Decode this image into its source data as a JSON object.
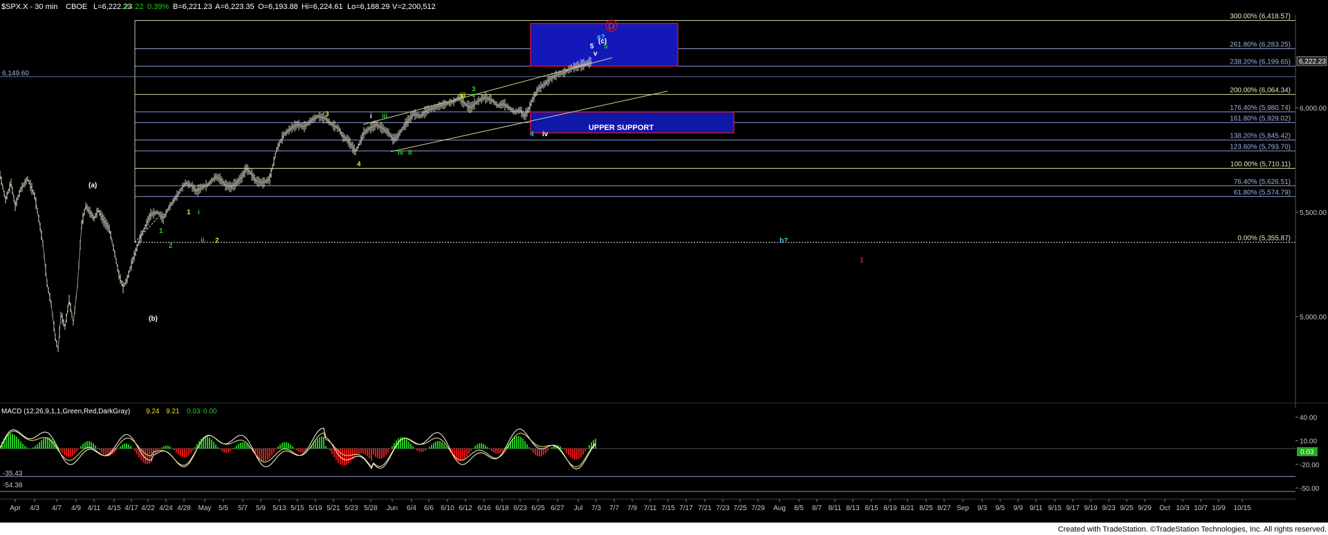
{
  "header": {
    "symbol": "$SPX.X - 30 min",
    "exchange": "CBOE",
    "last": "L=6,222.23",
    "change": "24.22",
    "pct": "0.39%",
    "bid": "B=6,221.23",
    "ask": "A=6,223.35",
    "open": "O=6,193.88",
    "high": "Hi=6,224.61",
    "low": "Lo=6,188.29",
    "volume": "V=2,200,512"
  },
  "macd_header": {
    "label": "MACD (12,26,9,1,1,Green,Red,DarkGray)",
    "v1": "9.24",
    "v2": "9.21",
    "v3": "0.03",
    "v4": "0.00"
  },
  "footer": "Created with TradeStation. ©TradeStation Technologies, Inc. All rights reserved.",
  "colors": {
    "background": "#000000",
    "price_bar": "#d8d8c8",
    "fib_line": "#c8c8c0",
    "fib_blue": "#1030c8",
    "support_box": "#1018a8",
    "support_border": "#c01838",
    "macd_pos": "#22c822",
    "macd_neg": "#e01818",
    "macd_line": "#ffffff",
    "signal_line": "#f0f080",
    "axis_text": "#c8c8c8"
  },
  "chart_data": {
    "type": "line",
    "title": "$SPX.X - 30 min",
    "price_axis": {
      "ticks": [
        "6,000.00",
        "5,500.00",
        "5,000.00"
      ],
      "current": "6,222.23",
      "ylim": [
        4600,
        6530
      ]
    },
    "level_left": "6,149.60",
    "fib_levels": [
      {
        "label": "300.00% (6,418.57)",
        "value": 6418.57,
        "tone": "yellow"
      },
      {
        "label": "261.80% (6,283.25)",
        "value": 6283.25,
        "tone": "blue"
      },
      {
        "label": "238.20% (6,199.65)",
        "value": 6199.65,
        "tone": "blue"
      },
      {
        "label": "200.00% (6,064.34)",
        "value": 6064.34,
        "tone": "yellow"
      },
      {
        "label": "176.40% (5,980.74)",
        "value": 5980.74,
        "tone": "blue"
      },
      {
        "label": "161.80% (5,929.02)",
        "value": 5929.02,
        "tone": "blue"
      },
      {
        "label": "138.20% (5,845.42)",
        "value": 5845.42,
        "tone": "blue"
      },
      {
        "label": "123.60% (5,793.70)",
        "value": 5793.7,
        "tone": "blue"
      },
      {
        "label": "100.00% (5,710.11)",
        "value": 5710.11,
        "tone": "yellow"
      },
      {
        "label": "76.40% (5,626.51)",
        "value": 5626.51,
        "tone": "blue"
      },
      {
        "label": "61.80% (5,574.79)",
        "value": 5574.79,
        "tone": "blue"
      },
      {
        "label": "0.00% (5,355.87)",
        "value": 5355.87,
        "tone": "dotted"
      }
    ],
    "zone_label": "UPPER SUPPORT",
    "x_ticks": [
      "Apr",
      "4/3",
      "4/7",
      "4/9",
      "4/11",
      "4/15",
      "4/17",
      "4/22",
      "4/24",
      "4/28",
      "May",
      "5/5",
      "5/7",
      "5/9",
      "5/13",
      "5/15",
      "5/19",
      "5/21",
      "5/23",
      "5/28",
      "Jun",
      "6/4",
      "6/6",
      "6/10",
      "6/12",
      "6/16",
      "6/18",
      "6/23",
      "6/25",
      "6/27",
      "Jul",
      "7/3",
      "7/7",
      "7/9",
      "7/11",
      "7/15",
      "7/17",
      "7/21",
      "7/23",
      "7/25",
      "7/29",
      "Aug",
      "8/5",
      "8/7",
      "8/11",
      "8/13",
      "8/15",
      "8/19",
      "8/21",
      "8/25",
      "8/27",
      "Sep",
      "9/3",
      "9/5",
      "9/9",
      "9/11",
      "9/15",
      "9/17",
      "9/19",
      "9/23",
      "9/25",
      "9/29",
      "Oct",
      "10/3",
      "10/7",
      "10/9",
      "10/15"
    ],
    "price_path": [
      [
        0,
        5680
      ],
      [
        8,
        5560
      ],
      [
        16,
        5640
      ],
      [
        22,
        5530
      ],
      [
        30,
        5610
      ],
      [
        40,
        5660
      ],
      [
        50,
        5580
      ],
      [
        56,
        5470
      ],
      [
        62,
        5350
      ],
      [
        68,
        5160
      ],
      [
        74,
        5060
      ],
      [
        80,
        4900
      ],
      [
        84,
        4840
      ],
      [
        88,
        5010
      ],
      [
        94,
        4950
      ],
      [
        100,
        5080
      ],
      [
        106,
        4970
      ],
      [
        112,
        5150
      ],
      [
        118,
        5440
      ],
      [
        124,
        5530
      ],
      [
        130,
        5500
      ],
      [
        136,
        5470
      ],
      [
        142,
        5510
      ],
      [
        150,
        5460
      ],
      [
        158,
        5420
      ],
      [
        166,
        5300
      ],
      [
        172,
        5200
      ],
      [
        178,
        5140
      ],
      [
        184,
        5180
      ],
      [
        190,
        5250
      ],
      [
        196,
        5310
      ],
      [
        202,
        5370
      ],
      [
        210,
        5430
      ],
      [
        218,
        5490
      ],
      [
        228,
        5500
      ],
      [
        236,
        5470
      ],
      [
        244,
        5520
      ],
      [
        252,
        5560
      ],
      [
        260,
        5600
      ],
      [
        268,
        5640
      ],
      [
        276,
        5630
      ],
      [
        284,
        5600
      ],
      [
        292,
        5620
      ],
      [
        300,
        5630
      ],
      [
        306,
        5650
      ],
      [
        312,
        5670
      ],
      [
        318,
        5660
      ],
      [
        326,
        5630
      ],
      [
        334,
        5620
      ],
      [
        342,
        5640
      ],
      [
        350,
        5670
      ],
      [
        356,
        5710
      ],
      [
        362,
        5690
      ],
      [
        370,
        5650
      ],
      [
        380,
        5640
      ],
      [
        390,
        5660
      ],
      [
        400,
        5800
      ],
      [
        410,
        5870
      ],
      [
        420,
        5900
      ],
      [
        430,
        5920
      ],
      [
        440,
        5910
      ],
      [
        450,
        5940
      ],
      [
        460,
        5960
      ],
      [
        470,
        5950
      ],
      [
        480,
        5920
      ],
      [
        490,
        5900
      ],
      [
        496,
        5860
      ],
      [
        502,
        5850
      ],
      [
        508,
        5820
      ],
      [
        514,
        5790
      ],
      [
        520,
        5830
      ],
      [
        526,
        5880
      ],
      [
        534,
        5900
      ],
      [
        544,
        5920
      ],
      [
        554,
        5900
      ],
      [
        562,
        5880
      ],
      [
        568,
        5850
      ],
      [
        574,
        5860
      ],
      [
        580,
        5890
      ],
      [
        588,
        5930
      ],
      [
        598,
        5970
      ],
      [
        608,
        5960
      ],
      [
        618,
        5990
      ],
      [
        628,
        6000
      ],
      [
        636,
        6010
      ],
      [
        646,
        6020
      ],
      [
        656,
        6030
      ],
      [
        664,
        6050
      ],
      [
        672,
        6020
      ],
      [
        680,
        6000
      ],
      [
        690,
        6030
      ],
      [
        700,
        6050
      ],
      [
        710,
        6040
      ],
      [
        720,
        6010
      ],
      [
        728,
        6020
      ],
      [
        736,
        6000
      ],
      [
        744,
        5980
      ],
      [
        752,
        5990
      ],
      [
        758,
        5960
      ],
      [
        764,
        5990
      ],
      [
        770,
        6040
      ],
      [
        778,
        6090
      ],
      [
        786,
        6110
      ],
      [
        796,
        6140
      ],
      [
        806,
        6160
      ],
      [
        816,
        6170
      ],
      [
        826,
        6190
      ],
      [
        836,
        6200
      ],
      [
        846,
        6210
      ],
      [
        856,
        6222.23
      ]
    ],
    "macd_axis": {
      "ticks": [
        "40.00",
        "10.00",
        "-20.00",
        "-50.00"
      ],
      "left_labels": [
        "-35.43",
        "-54.38"
      ],
      "current": "0.03",
      "ylim": [
        -55,
        65
      ]
    },
    "wave_labels": [
      {
        "text": "(a)",
        "x": 128,
        "price": 5620,
        "color": "#ffffff"
      },
      {
        "text": "(b)",
        "x": 215,
        "price": 4980,
        "color": "#ffffff"
      },
      {
        "text": "1",
        "x": 230,
        "price": 5400,
        "color": "#22cc22"
      },
      {
        "text": "2",
        "x": 244,
        "price": 5330,
        "color": "#22cc22"
      },
      {
        "text": "1",
        "x": 270,
        "price": 5490,
        "color": "#e8e020"
      },
      {
        "text": "i",
        "x": 286,
        "price": 5490,
        "color": "#22cc22"
      },
      {
        "text": "ii",
        "x": 290,
        "price": 5355,
        "color": "#22cc22"
      },
      {
        "text": "2",
        "x": 311,
        "price": 5355,
        "color": "#e8e020"
      },
      {
        "text": "3",
        "x": 470,
        "price": 5960,
        "color": "#e8e020"
      },
      {
        "text": "4",
        "x": 516,
        "price": 5720,
        "color": "#e8e020"
      },
      {
        "text": "i",
        "x": 535,
        "price": 5950,
        "color": "#ffffff"
      },
      {
        "text": "iii",
        "x": 552,
        "price": 5950,
        "color": "#22cc22"
      },
      {
        "text": "iv",
        "x": 575,
        "price": 5775,
        "color": "#22cc22"
      },
      {
        "text": "ii",
        "x": 590,
        "price": 5775,
        "color": "#22cc22"
      },
      {
        "text": "iii",
        "x": 665,
        "price": 6050,
        "color": "#e8e020"
      },
      {
        "text": "v",
        "x": 682,
        "price": 6050,
        "color": "#22cc22"
      },
      {
        "text": "3",
        "x": 682,
        "price": 6080,
        "color": "#22cc22"
      },
      {
        "text": "4",
        "x": 766,
        "price": 5865,
        "color": "#22cccc"
      },
      {
        "text": "iv",
        "x": 784,
        "price": 5865,
        "color": "#ffffff"
      },
      {
        "text": "v",
        "x": 858,
        "price": 6250,
        "color": "#ffffff"
      },
      {
        "text": "5",
        "x": 853,
        "price": 6285,
        "color": "#ffffff"
      },
      {
        "text": "5",
        "x": 873,
        "price": 6285,
        "color": "#22cc22"
      },
      {
        "text": "(c)",
        "x": 865,
        "price": 6310,
        "color": "#ffffff"
      },
      {
        "text": "a?",
        "x": 863,
        "price": 6330,
        "color": "#40c8e8"
      },
      {
        "text": "b?",
        "x": 1127,
        "price": 5355,
        "color": "#40c8e8"
      },
      {
        "text": "1",
        "x": 1243,
        "price": 5260,
        "color": "#e02020"
      }
    ],
    "circle_label": "D"
  }
}
